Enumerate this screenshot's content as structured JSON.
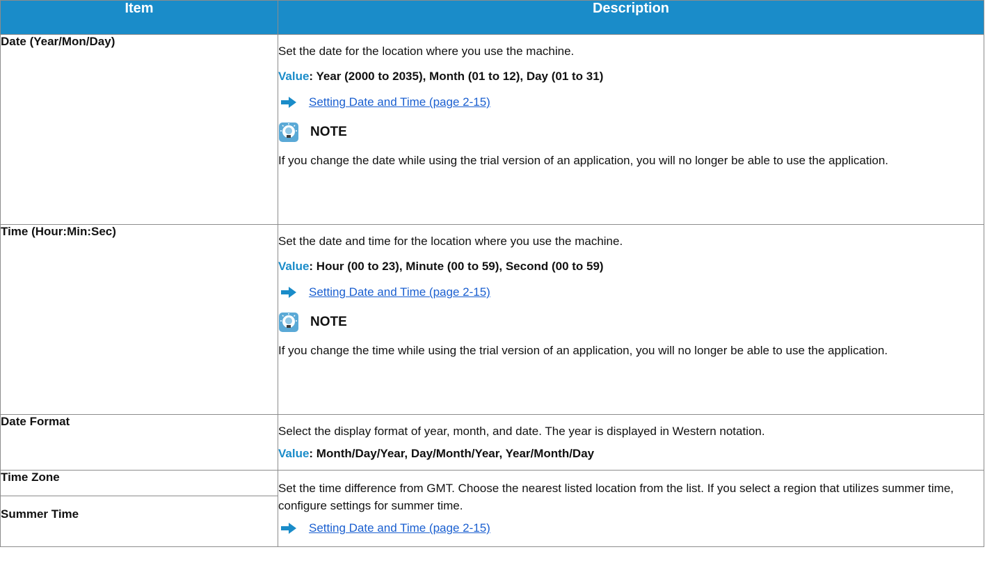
{
  "header": {
    "item": "Item",
    "description": "Description"
  },
  "rows": [
    {
      "item": "Date (Year/Mon/Day)",
      "text": "Set the date for the location where you use the machine.",
      "value_label": "Value",
      "value_text": ": Year (2000 to 2035), Month (01 to 12), Day (01 to 31)",
      "link": "Setting Date and Time (page 2-15)",
      "note_title": "NOTE",
      "note_text": "If you change the date while using the trial version of an application, you will no longer be able to use the application."
    },
    {
      "item": "Time (Hour:Min:Sec)",
      "text": "Set the date and time for the location where you use the machine.",
      "value_label": "Value",
      "value_text": ": Hour (00 to 23), Minute (00 to 59), Second (00 to 59)",
      "link": "Setting Date and Time (page 2-15)",
      "note_title": "NOTE",
      "note_text": "If you change the time while using the trial version of an application, you will no longer be able to use the application."
    },
    {
      "item": "Date Format",
      "text": "Select the display format of year, month, and date. The year is displayed in Western notation.",
      "value_label": "Value",
      "value_text": ": Month/Day/Year, Day/Month/Year, Year/Month/Day"
    },
    {
      "item": "Time Zone",
      "item2": "Summer Time",
      "text": "Set the time difference from GMT. Choose the nearest listed location from the list. If you select a region that utilizes summer time, configure settings for summer time.",
      "link": "Setting Date and Time (page 2-15)"
    }
  ],
  "colors": {
    "header_bg": "#1a8cc9",
    "value_label": "#1a8cc9",
    "link": "#1a5fd0",
    "arrow": "#1a8cc9",
    "border": "#8c8c8c"
  },
  "icons": {
    "arrow": "right-arrow-icon",
    "note": "note-lightbulb-icon"
  }
}
